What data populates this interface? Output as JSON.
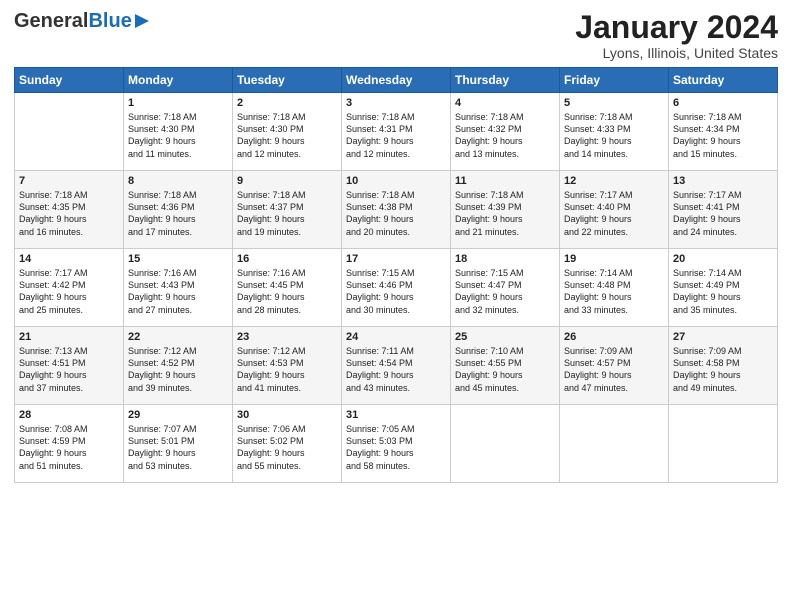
{
  "header": {
    "logo_general": "General",
    "logo_blue": "Blue",
    "title": "January 2024",
    "subtitle": "Lyons, Illinois, United States"
  },
  "days_of_week": [
    "Sunday",
    "Monday",
    "Tuesday",
    "Wednesday",
    "Thursday",
    "Friday",
    "Saturday"
  ],
  "weeks": [
    [
      {
        "num": "",
        "info": ""
      },
      {
        "num": "1",
        "info": "Sunrise: 7:18 AM\nSunset: 4:30 PM\nDaylight: 9 hours\nand 11 minutes."
      },
      {
        "num": "2",
        "info": "Sunrise: 7:18 AM\nSunset: 4:30 PM\nDaylight: 9 hours\nand 12 minutes."
      },
      {
        "num": "3",
        "info": "Sunrise: 7:18 AM\nSunset: 4:31 PM\nDaylight: 9 hours\nand 12 minutes."
      },
      {
        "num": "4",
        "info": "Sunrise: 7:18 AM\nSunset: 4:32 PM\nDaylight: 9 hours\nand 13 minutes."
      },
      {
        "num": "5",
        "info": "Sunrise: 7:18 AM\nSunset: 4:33 PM\nDaylight: 9 hours\nand 14 minutes."
      },
      {
        "num": "6",
        "info": "Sunrise: 7:18 AM\nSunset: 4:34 PM\nDaylight: 9 hours\nand 15 minutes."
      }
    ],
    [
      {
        "num": "7",
        "info": "Sunrise: 7:18 AM\nSunset: 4:35 PM\nDaylight: 9 hours\nand 16 minutes."
      },
      {
        "num": "8",
        "info": "Sunrise: 7:18 AM\nSunset: 4:36 PM\nDaylight: 9 hours\nand 17 minutes."
      },
      {
        "num": "9",
        "info": "Sunrise: 7:18 AM\nSunset: 4:37 PM\nDaylight: 9 hours\nand 19 minutes."
      },
      {
        "num": "10",
        "info": "Sunrise: 7:18 AM\nSunset: 4:38 PM\nDaylight: 9 hours\nand 20 minutes."
      },
      {
        "num": "11",
        "info": "Sunrise: 7:18 AM\nSunset: 4:39 PM\nDaylight: 9 hours\nand 21 minutes."
      },
      {
        "num": "12",
        "info": "Sunrise: 7:17 AM\nSunset: 4:40 PM\nDaylight: 9 hours\nand 22 minutes."
      },
      {
        "num": "13",
        "info": "Sunrise: 7:17 AM\nSunset: 4:41 PM\nDaylight: 9 hours\nand 24 minutes."
      }
    ],
    [
      {
        "num": "14",
        "info": "Sunrise: 7:17 AM\nSunset: 4:42 PM\nDaylight: 9 hours\nand 25 minutes."
      },
      {
        "num": "15",
        "info": "Sunrise: 7:16 AM\nSunset: 4:43 PM\nDaylight: 9 hours\nand 27 minutes."
      },
      {
        "num": "16",
        "info": "Sunrise: 7:16 AM\nSunset: 4:45 PM\nDaylight: 9 hours\nand 28 minutes."
      },
      {
        "num": "17",
        "info": "Sunrise: 7:15 AM\nSunset: 4:46 PM\nDaylight: 9 hours\nand 30 minutes."
      },
      {
        "num": "18",
        "info": "Sunrise: 7:15 AM\nSunset: 4:47 PM\nDaylight: 9 hours\nand 32 minutes."
      },
      {
        "num": "19",
        "info": "Sunrise: 7:14 AM\nSunset: 4:48 PM\nDaylight: 9 hours\nand 33 minutes."
      },
      {
        "num": "20",
        "info": "Sunrise: 7:14 AM\nSunset: 4:49 PM\nDaylight: 9 hours\nand 35 minutes."
      }
    ],
    [
      {
        "num": "21",
        "info": "Sunrise: 7:13 AM\nSunset: 4:51 PM\nDaylight: 9 hours\nand 37 minutes."
      },
      {
        "num": "22",
        "info": "Sunrise: 7:12 AM\nSunset: 4:52 PM\nDaylight: 9 hours\nand 39 minutes."
      },
      {
        "num": "23",
        "info": "Sunrise: 7:12 AM\nSunset: 4:53 PM\nDaylight: 9 hours\nand 41 minutes."
      },
      {
        "num": "24",
        "info": "Sunrise: 7:11 AM\nSunset: 4:54 PM\nDaylight: 9 hours\nand 43 minutes."
      },
      {
        "num": "25",
        "info": "Sunrise: 7:10 AM\nSunset: 4:55 PM\nDaylight: 9 hours\nand 45 minutes."
      },
      {
        "num": "26",
        "info": "Sunrise: 7:09 AM\nSunset: 4:57 PM\nDaylight: 9 hours\nand 47 minutes."
      },
      {
        "num": "27",
        "info": "Sunrise: 7:09 AM\nSunset: 4:58 PM\nDaylight: 9 hours\nand 49 minutes."
      }
    ],
    [
      {
        "num": "28",
        "info": "Sunrise: 7:08 AM\nSunset: 4:59 PM\nDaylight: 9 hours\nand 51 minutes."
      },
      {
        "num": "29",
        "info": "Sunrise: 7:07 AM\nSunset: 5:01 PM\nDaylight: 9 hours\nand 53 minutes."
      },
      {
        "num": "30",
        "info": "Sunrise: 7:06 AM\nSunset: 5:02 PM\nDaylight: 9 hours\nand 55 minutes."
      },
      {
        "num": "31",
        "info": "Sunrise: 7:05 AM\nSunset: 5:03 PM\nDaylight: 9 hours\nand 58 minutes."
      },
      {
        "num": "",
        "info": ""
      },
      {
        "num": "",
        "info": ""
      },
      {
        "num": "",
        "info": ""
      }
    ]
  ]
}
